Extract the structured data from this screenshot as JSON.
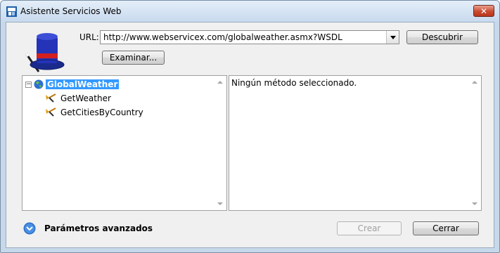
{
  "window": {
    "title": "Asistente Servicios Web",
    "close_label": "✕"
  },
  "url": {
    "label": "URL:",
    "value": "http://www.webservicex.com/globalweather.asmx?WSDL"
  },
  "buttons": {
    "discover": "Descubrir",
    "browse": "Examinar...",
    "create": "Crear",
    "close": "Cerrar"
  },
  "tree": {
    "root": {
      "label": "GlobalWeather",
      "expander": "−"
    },
    "methods": [
      "GetWeather",
      "GetCitiesByCountry"
    ]
  },
  "detail": {
    "text": "Ningún método seleccionado."
  },
  "advanced": {
    "label": "Parámetros avanzados"
  },
  "icons": {
    "title": "web-services-wizard-icon",
    "wizard": "magic-hat-icon",
    "service": "globe-icon",
    "method": "method-icon",
    "advanced": "chevron-down-circle-icon"
  },
  "colors": {
    "selection": "#3399ff",
    "close_button": "#c94a30",
    "advanced_icon": "#2a6fc9"
  }
}
